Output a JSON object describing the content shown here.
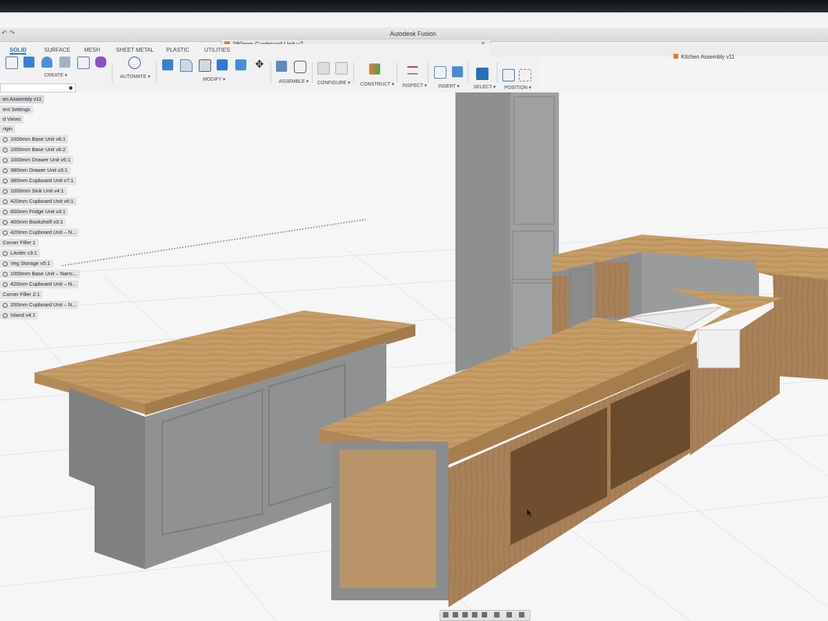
{
  "app": {
    "title": "Autodesk Fusion"
  },
  "document": {
    "tab_label": "380mm Cupboard Unit v7",
    "close_glyph": "×",
    "related_tab_label": "Kitchen Assembly v11"
  },
  "toolbar": {
    "tabs": [
      "SOLID",
      "SURFACE",
      "MESH",
      "SHEET METAL",
      "PLASTIC",
      "UTILITIES"
    ],
    "active_tab": "SOLID",
    "groups": [
      "CREATE ▾",
      "AUTOMATE ▾",
      "MODIFY ▾",
      "ASSEMBLE ▾",
      "CONFIGURE ▾",
      "CONSTRUCT ▾",
      "INSPECT ▾",
      "INSERT ▾",
      "SELECT ▾",
      "POSITION ▾"
    ]
  },
  "browser": {
    "root": "en Assembly v11",
    "items": [
      "ent Settings",
      "d Views",
      "rigin",
      "1000mm Base Unit v6:1",
      "1000mm Base Unit v6:2",
      "1000mm Drawer Unit v5:1",
      "380mm Drawer Unit v3:1",
      "380mm Cupboard Unit v7:1",
      "1000mm Sink Unit v4:1",
      "420mm Cupboard Unit v6:1",
      "600mm Fridge Unit v3:1",
      "400mm Bookshelf v3:1",
      "420mm Cupboard Unit – N...",
      "Corner Filler:1",
      "LArder v3:1",
      "Veg Storage v5:1",
      "1000mm Base Unit – Narrc...",
      "420mm Cupboard Unit – N...",
      "Corner Filler 2:1",
      "200mm Cupboard Unit – N...",
      "Island v4:1"
    ]
  },
  "colors": {
    "wood": "#c39a63",
    "cabinet": "#8a8c8c",
    "select_blue": "#2a6fb6",
    "grid_line": "#dcdcdc"
  },
  "icons": [
    "sketch-icon",
    "extrude-icon",
    "fillet-icon",
    "shell-icon",
    "move-icon",
    "joint-icon",
    "construct-icon",
    "measure-icon",
    "select-icon",
    "position-icon"
  ]
}
